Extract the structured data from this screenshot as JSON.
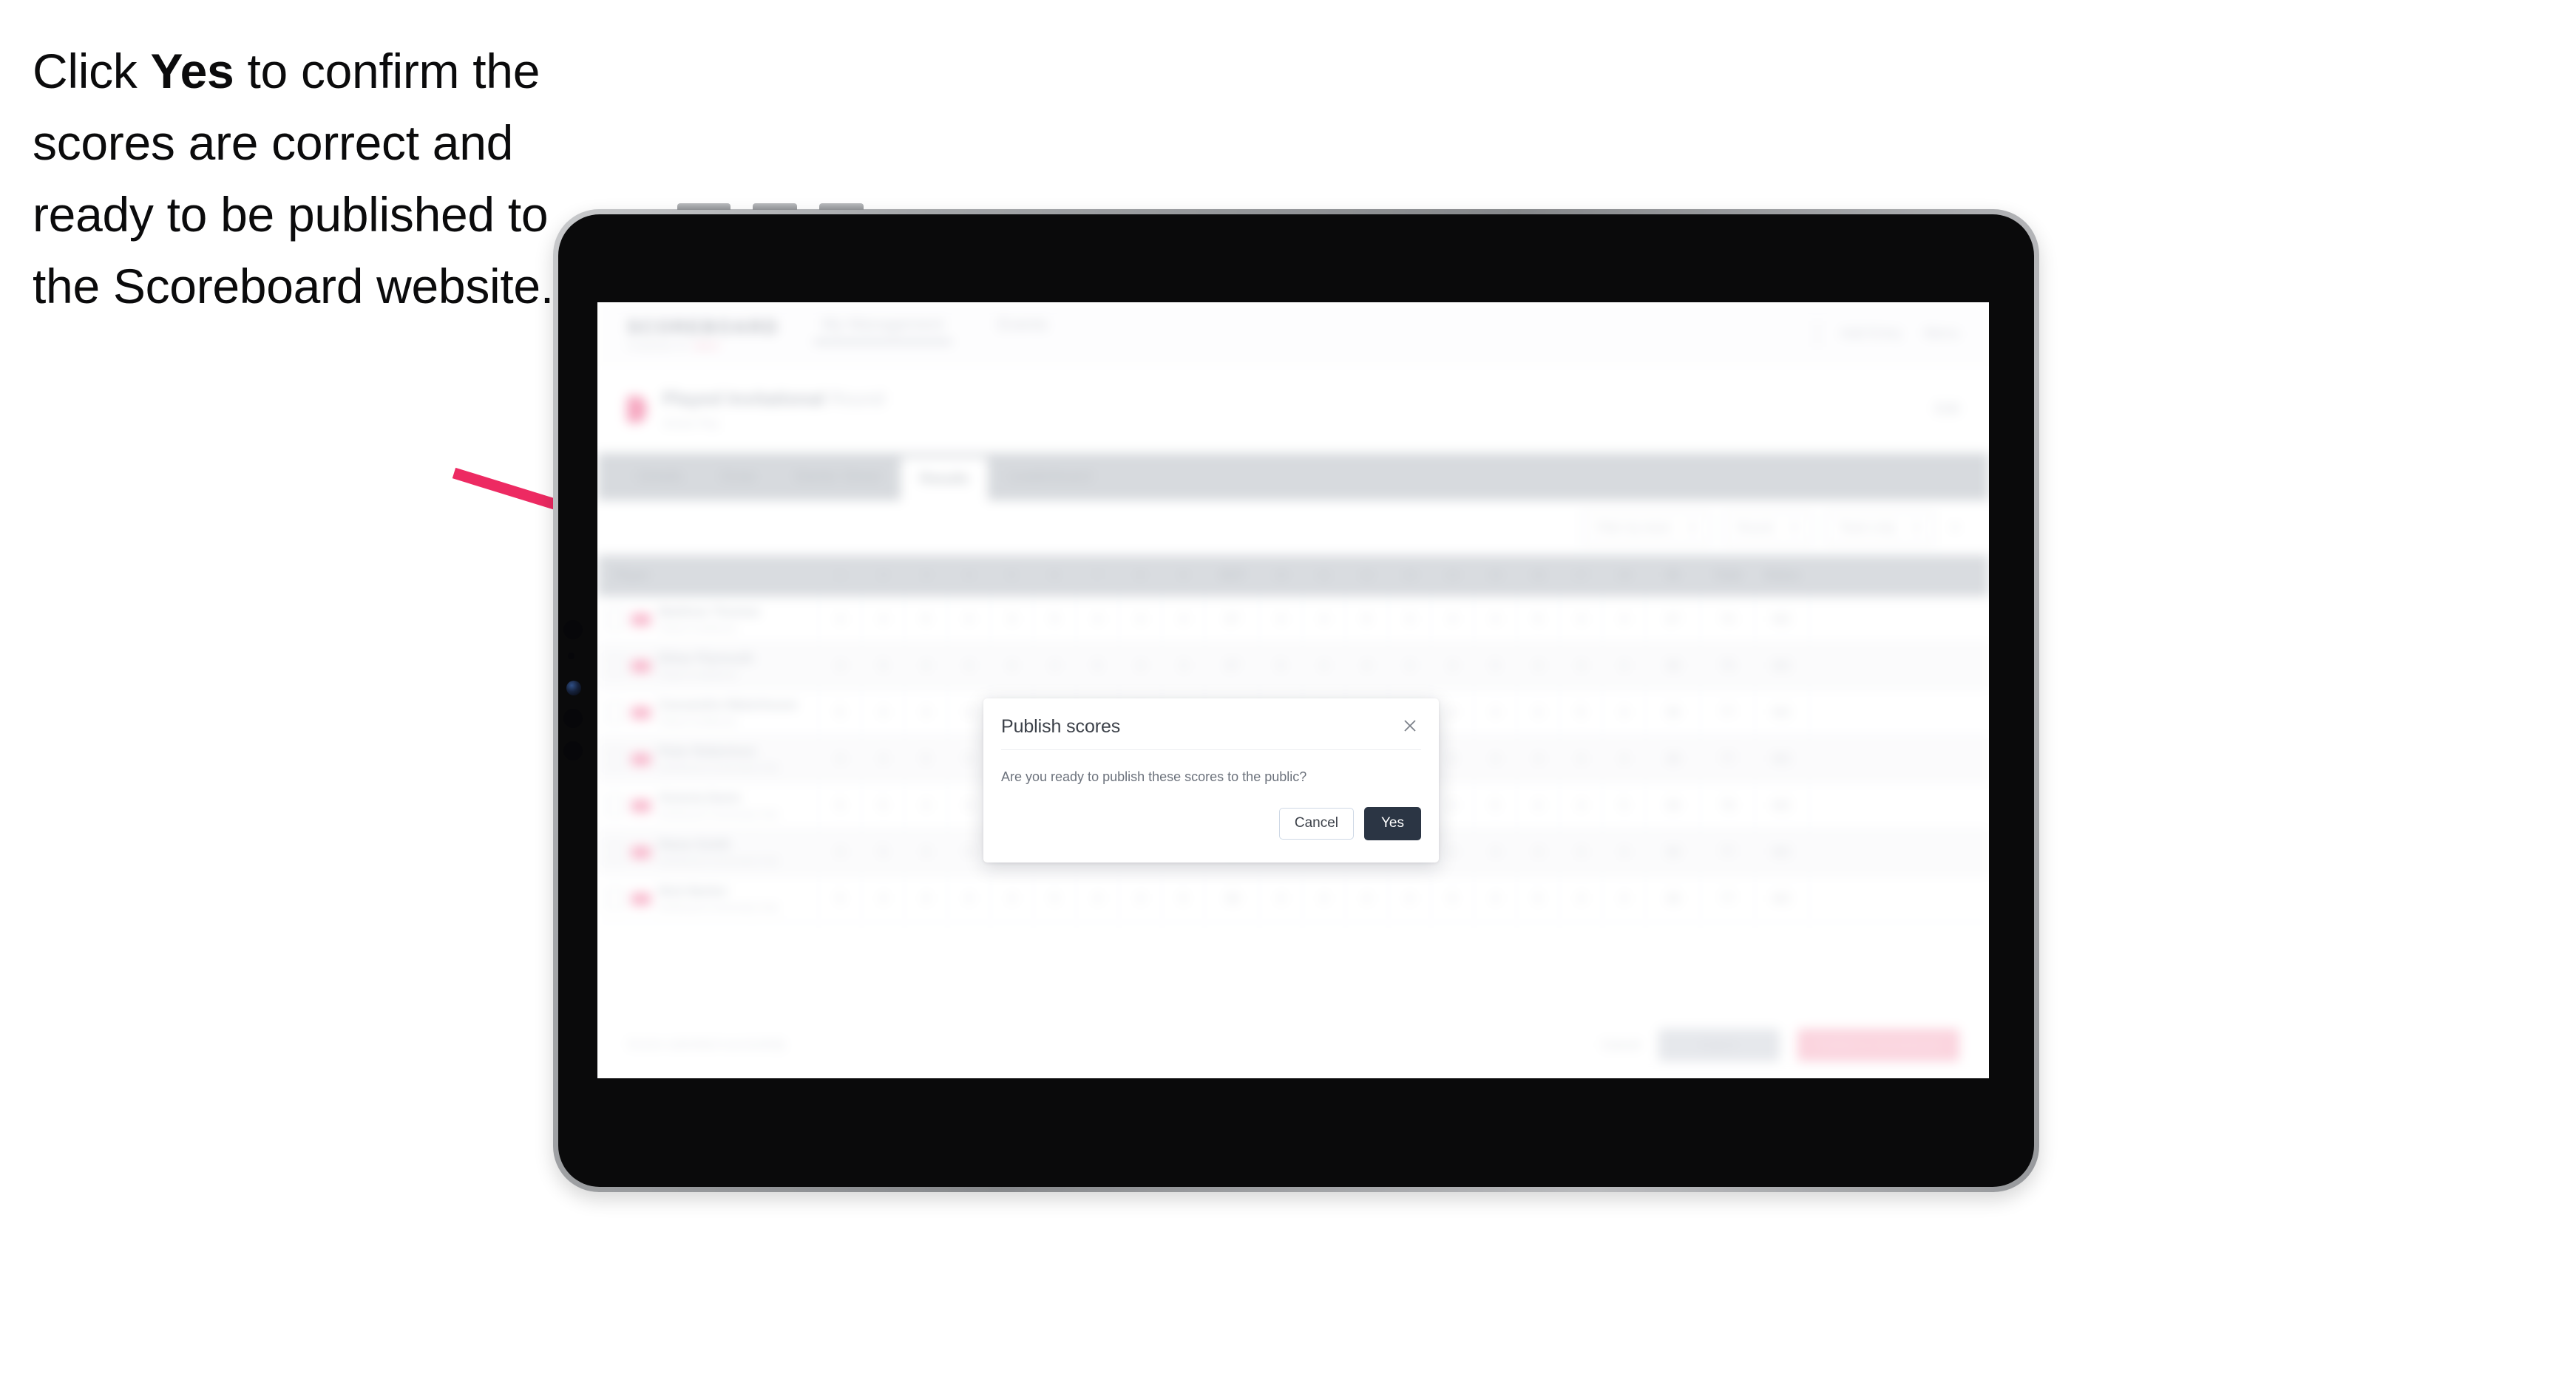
{
  "instruction": {
    "before": "Click ",
    "emphasis": "Yes",
    "after": " to confirm the scores are correct and ready to be published to the Scoreboard website."
  },
  "annotation": {
    "arrow_color": "#ED2A62",
    "arrow_name": "pointer-arrow"
  },
  "device": {
    "type": "tablet",
    "frame_color": "#0a0a0b",
    "bezel_color": "#9b9da0"
  },
  "app": {
    "topbar": {
      "logo_wordmark": "SCOREBOARD",
      "logo_sub": "POWERED BY",
      "logo_sub_accent": "GOLF",
      "nav_links": [
        "My Management",
        "Events"
      ],
      "right_items": [
        "Add Entry",
        "Menu"
      ]
    },
    "event_header": {
      "title": "Played Invitational",
      "title_suffix": "Round",
      "meta": "Stroke Play",
      "right": "Edit"
    },
    "tabs": [
      {
        "label": "Details",
        "active": false
      },
      {
        "label": "Draw",
        "active": false
      },
      {
        "label": "Starter Sheet",
        "active": false
      },
      {
        "label": "Results",
        "active": true
      },
      {
        "label": "Leaderboard",
        "active": false
      }
    ],
    "filters": [
      {
        "label": "Filter by team",
        "caret": true
      },
      {
        "label": "Round",
        "caret": true
      },
      {
        "label": "Team only",
        "caret": true
      }
    ],
    "filter_clear_label": "×",
    "table": {
      "headers": [
        "Player",
        "1",
        "2",
        "3",
        "4",
        "5",
        "6",
        "7",
        "8",
        "9",
        "OUT",
        "10",
        "11",
        "12",
        "13",
        "14",
        "15",
        "16",
        "17",
        "18",
        "IN",
        "Total",
        "Status"
      ],
      "rows": [
        {
          "name": "Matthew Thomas",
          "club": "Played Invitational",
          "scores": [
            "4",
            "4",
            "5",
            "4",
            "3",
            "5",
            "4",
            "4",
            "4",
            "37",
            "4",
            "4",
            "5",
            "3",
            "4",
            "4",
            "5",
            "4",
            "4",
            "37",
            "74",
            "MC"
          ],
          "total": "74",
          "status": "MC"
        },
        {
          "name": "Ethan Plymouth",
          "club": "Played Invitational",
          "scores": [
            "4",
            "5",
            "4",
            "4",
            "4",
            "4",
            "5",
            "4",
            "3",
            "37",
            "5",
            "4",
            "4",
            "4",
            "4",
            "5",
            "4",
            "4",
            "4",
            "38",
            "75",
            "MC"
          ],
          "total": "75",
          "status": "MC"
        },
        {
          "name": "Cassandra Waterhouse",
          "club": "Played Invitational",
          "scores": [
            "5",
            "4",
            "4",
            "4",
            "4",
            "5",
            "4",
            "5",
            "4",
            "39",
            "4",
            "5",
            "4",
            "4",
            "4",
            "4",
            "4",
            "5",
            "4",
            "38",
            "77",
            "MC"
          ],
          "total": "77",
          "status": "MC"
        },
        {
          "name": "Peter Robertson",
          "club": "Northwood Community Club",
          "scores": [
            "4",
            "4",
            "5",
            "5",
            "4",
            "4",
            "4",
            "4",
            "5",
            "39",
            "4",
            "4",
            "5",
            "4",
            "5",
            "4",
            "4",
            "4",
            "4",
            "38",
            "77",
            "MC"
          ],
          "total": "77",
          "status": "MC"
        },
        {
          "name": "Victoria Davis",
          "club": "Northwood Community Club",
          "scores": [
            "5",
            "5",
            "4",
            "4",
            "5",
            "4",
            "4",
            "4",
            "4",
            "39",
            "5",
            "4",
            "4",
            "4",
            "4",
            "5",
            "4",
            "4",
            "5",
            "39",
            "78",
            "MC"
          ],
          "total": "78",
          "status": "MC"
        },
        {
          "name": "Diana Smith",
          "club": "Northwood Community Club",
          "scores": [
            "4",
            "5",
            "4",
            "5",
            "4",
            "4",
            "5",
            "4",
            "4",
            "39",
            "4",
            "5",
            "4",
            "5",
            "4",
            "4",
            "4",
            "4",
            "4",
            "38",
            "77",
            "MC"
          ],
          "total": "77",
          "status": "MC"
        },
        {
          "name": "Nick Barker",
          "club": "Northwood Community Club",
          "scores": [
            "5",
            "4",
            "4",
            "4",
            "4",
            "5",
            "4",
            "4",
            "5",
            "39",
            "4",
            "4",
            "4",
            "4",
            "5",
            "4",
            "5",
            "4",
            "4",
            "38",
            "77",
            "MC"
          ],
          "total": "77",
          "status": "MC"
        }
      ]
    },
    "bottombar": {
      "status": "Scores submitted successfully",
      "link_label": "Cancel",
      "secondary_label": "Export",
      "primary_label": "Publish to Scoreboard"
    }
  },
  "dialog": {
    "title": "Publish scores",
    "body": "Are you ready to publish these scores to the public?",
    "cancel_label": "Cancel",
    "confirm_label": "Yes",
    "close_icon": "close-icon",
    "confirm_color": "#2b3544"
  }
}
